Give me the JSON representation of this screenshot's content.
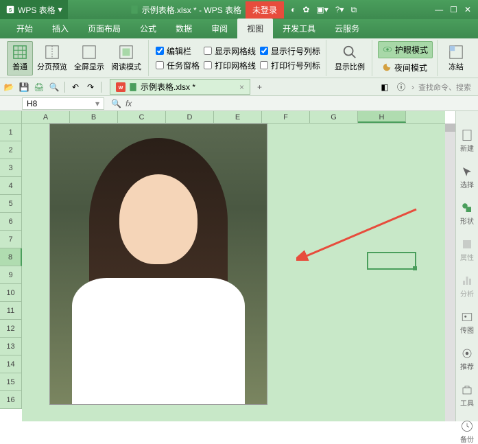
{
  "titlebar": {
    "app_name": "WPS 表格",
    "doc_title": "示例表格.xlsx * - WPS 表格",
    "login_label": "未登录"
  },
  "menu": {
    "items": [
      "开始",
      "插入",
      "页面布局",
      "公式",
      "数据",
      "审阅",
      "视图",
      "开发工具",
      "云服务"
    ],
    "active_index": 6
  },
  "ribbon": {
    "normal": "普通",
    "page_break": "分页预览",
    "fullscreen": "全屏显示",
    "read_mode": "阅读模式",
    "chk_formula": "编辑栏",
    "chk_task": "任务窗格",
    "chk_grid": "显示网格线",
    "chk_print_grid": "打印网格线",
    "chk_rowcol": "显示行号列标",
    "chk_print_rowcol": "打印行号列标",
    "zoom": "显示比例",
    "eye_mode": "护眼模式",
    "night_mode": "夜间模式",
    "freeze": "冻结"
  },
  "tab": {
    "filename": "示例表格.xlsx *"
  },
  "search": {
    "placeholder": "查找命令、搜索"
  },
  "namebox": {
    "cell_ref": "H8"
  },
  "columns": [
    "A",
    "B",
    "C",
    "D",
    "E",
    "F",
    "G",
    "H"
  ],
  "rows": [
    "1",
    "2",
    "3",
    "4",
    "5",
    "6",
    "7",
    "8",
    "9",
    "10",
    "11",
    "12",
    "13",
    "14",
    "15",
    "16"
  ],
  "selected_col_index": 7,
  "selected_row_index": 7,
  "sidepanel": {
    "new": "新建",
    "select": "选择",
    "shape": "形状",
    "props": "属性",
    "analyze": "分析",
    "pic": "传图",
    "recommend": "推荐",
    "tools": "工具",
    "backup": "备份"
  }
}
